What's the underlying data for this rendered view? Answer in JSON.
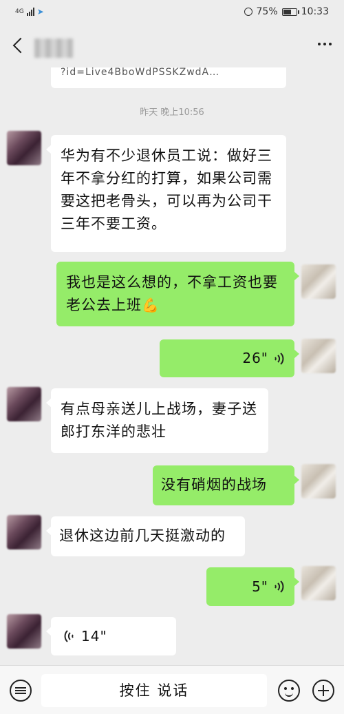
{
  "status_bar": {
    "network": "4G",
    "battery": "75%",
    "battery_level": 0.75,
    "time": "10:33"
  },
  "nav": {
    "back_icon": "chevron-left-icon",
    "more_icon": "more-dots-icon"
  },
  "chat": {
    "link_preview": "?id=Live4BboWdPSSKZwdA…",
    "timestamp": "昨天 晚上10:56",
    "messages": [
      {
        "side": "in",
        "type": "text",
        "text": "华为有不少退休员工说：做好三年不拿分红的打算，如果公司需要这把老骨头，可以再为公司干三年不要工资。"
      },
      {
        "side": "out",
        "type": "text",
        "text": "我也是这么想的，不拿工资也要老公去上班",
        "emoji": "💪"
      },
      {
        "side": "out",
        "type": "voice",
        "duration": "26\""
      },
      {
        "side": "in",
        "type": "text",
        "text": "有点母亲送儿上战场，妻子送郎打东洋的悲壮"
      },
      {
        "side": "out",
        "type": "text",
        "text": "没有硝烟的战场"
      },
      {
        "side": "in",
        "type": "text",
        "text": "退休这边前几天挺激动的"
      },
      {
        "side": "out",
        "type": "voice",
        "duration": "5\""
      },
      {
        "side": "in",
        "type": "voice",
        "duration": "14\""
      }
    ]
  },
  "input_bar": {
    "hold_to_talk": "按住 说话",
    "keyboard_icon": "keyboard-icon",
    "emoji_icon": "emoji-icon",
    "plus_icon": "plus-icon"
  },
  "colors": {
    "background": "#ededed",
    "bubble_out": "#95ec69",
    "bubble_in": "#ffffff"
  }
}
